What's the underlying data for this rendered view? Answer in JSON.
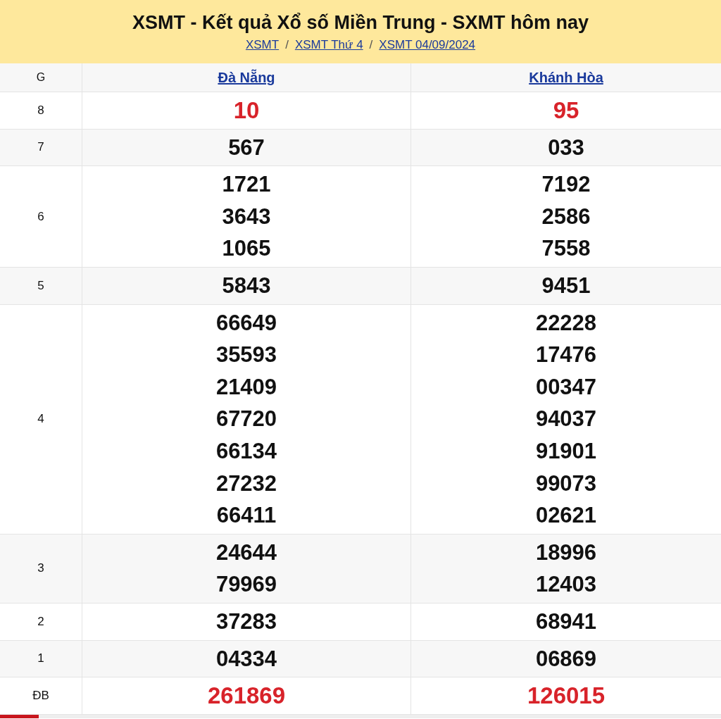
{
  "title": "XSMT - Kết quả Xổ số Miền Trung - SXMT hôm nay",
  "breadcrumbs": [
    "XSMT",
    "XSMT Thứ 4",
    "XSMT 04/09/2024"
  ],
  "breadcrumb_separator": "/",
  "table": {
    "columns": [
      "G",
      "Đà Nẵng",
      "Khánh Hòa"
    ],
    "rows": [
      {
        "prize": "8",
        "highlight": true,
        "values": [
          [
            "10"
          ],
          [
            "95"
          ]
        ]
      },
      {
        "prize": "7",
        "highlight": false,
        "values": [
          [
            "567"
          ],
          [
            "033"
          ]
        ]
      },
      {
        "prize": "6",
        "highlight": false,
        "values": [
          [
            "1721",
            "3643",
            "1065"
          ],
          [
            "7192",
            "2586",
            "7558"
          ]
        ]
      },
      {
        "prize": "5",
        "highlight": false,
        "values": [
          [
            "5843"
          ],
          [
            "9451"
          ]
        ]
      },
      {
        "prize": "4",
        "highlight": false,
        "values": [
          [
            "66649",
            "35593",
            "21409",
            "67720",
            "66134",
            "27232",
            "66411"
          ],
          [
            "22228",
            "17476",
            "00347",
            "94037",
            "91901",
            "99073",
            "02621"
          ]
        ]
      },
      {
        "prize": "3",
        "highlight": false,
        "values": [
          [
            "24644",
            "79969"
          ],
          [
            "18996",
            "12403"
          ]
        ]
      },
      {
        "prize": "2",
        "highlight": false,
        "values": [
          [
            "37283"
          ],
          [
            "68941"
          ]
        ]
      },
      {
        "prize": "1",
        "highlight": false,
        "values": [
          [
            "04334"
          ],
          [
            "06869"
          ]
        ]
      },
      {
        "prize": "ĐB",
        "highlight": true,
        "values": [
          [
            "261869"
          ],
          [
            "126015"
          ]
        ]
      }
    ]
  }
}
